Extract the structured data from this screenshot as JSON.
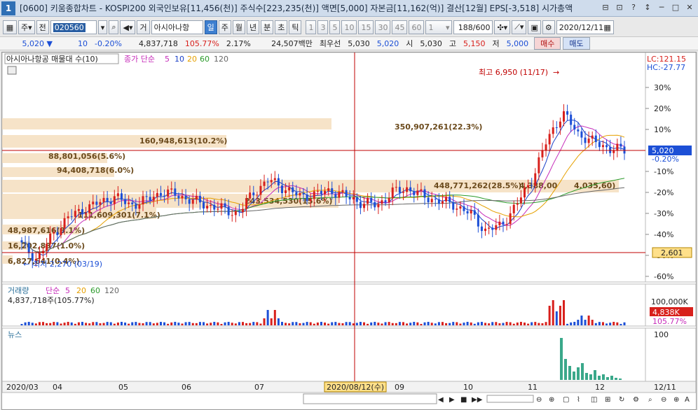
{
  "window": {
    "number": "1",
    "title": "[0600] 키움종합차트 - KOSPI200 외국인보유[11,456(천)] 주식수[223,235(천)] 액면[5,000] 자본금[11,162(억)] 결산[12월] EPS[-3,518] 시가총액",
    "buttons": [
      "⊟",
      "⊡",
      "?",
      "↕",
      "─",
      "□",
      "✕"
    ]
  },
  "toolbar": {
    "type_value": "주",
    "prev_label": "전",
    "code_value": "020560",
    "group_label": "거",
    "stock_name": "아시아나항",
    "periods": [
      "일",
      "주",
      "월",
      "년",
      "분",
      "초",
      "틱"
    ],
    "selected_period": "일",
    "intervals": [
      "1",
      "3",
      "5",
      "10",
      "15",
      "30",
      "45",
      "60"
    ],
    "interval_select": "1",
    "count": "188/600",
    "date": "2020/12/11"
  },
  "quote": {
    "price": "5,020",
    "change": "10",
    "change_pct": "-0.20%",
    "volume": "4,837,718",
    "volume_ratio": "105.77%",
    "turnover": "2.17%",
    "amount": "24,507백만",
    "best_label": "최우선",
    "best_ask": "5,030",
    "best_bid": "5,020",
    "open_label": "시",
    "open": "5,030",
    "high_label": "고",
    "high": "5,150",
    "low_label": "저",
    "low": "5,000",
    "buy_label": "매수",
    "sell_label": "매도"
  },
  "colors": {
    "up": "#d8201c",
    "down": "#1c4fd6",
    "ma5": "#1a3fc7",
    "ma10": "#c62bb9",
    "ma20": "#e6a000",
    "ma60": "#2a9a2a",
    "ma120": "#666666",
    "crosshair": "#c00000",
    "profile": "#f6e3c8"
  },
  "price_pane": {
    "legend_name": "아시아나항공 매물대 수(10)",
    "legend_ma_label": "종가 단순",
    "legend_periods": [
      "5",
      "10",
      "20",
      "60",
      "120"
    ],
    "lc_label": "LC:121.15",
    "hc_label": "HC:-27.77",
    "high_marker": "최고 6,950 (11/17)",
    "low_marker": "최저 2,270 (03/19)",
    "current_price_tag": "5,020",
    "current_pct": "-0.20%",
    "line_tag": "2,601",
    "pct_ticks": [
      "30%",
      "20%",
      "10%",
      "-10%",
      "-20%",
      "-30%",
      "-40%",
      "-50%",
      "-60%"
    ],
    "profile_labels": [
      "350,907,261(22.3%)",
      "160,948,613(10.2%)",
      "88,801,056(5.6%)",
      "94,408,718(6.0%)",
      "448,771,262(28.5%)",
      "4,388,00",
      "4,035,60)",
      "243,534,530(15.6%)",
      "111,609,301(7.1%)",
      "48,987,616(3.1%)",
      "16,202,837(1.0%)",
      "6,827,641(0.4%)"
    ]
  },
  "volume_pane": {
    "legend_name": "거래량",
    "legend_ma_label": "단순",
    "legend_periods": [
      "5",
      "20",
      "60",
      "120"
    ],
    "value_label": "4,837,718주(105.77%)",
    "axis_label": "100,000K",
    "tag_value": "4,838K",
    "tag_pct": "105.77%"
  },
  "news_pane": {
    "legend_name": "뉴스",
    "axis_label": "100"
  },
  "x_axis": {
    "labels": [
      "2020/03",
      "04",
      "05",
      "06",
      "07",
      "09",
      "10",
      "11",
      "12",
      "12/11"
    ],
    "crosshair_date": "2020/08/12(수)"
  },
  "chart_data": {
    "type": "candlestick",
    "y_unit": "% change",
    "monthly_marks": [
      "2020/03",
      "04",
      "05",
      "06",
      "07",
      "08",
      "09",
      "10",
      "11",
      "12"
    ],
    "close_path_pct": [
      -45,
      -52,
      -40,
      -32,
      -28,
      -25,
      -22,
      -26,
      -24,
      -20,
      -21,
      -24,
      -26,
      -28,
      -30,
      -20,
      -14,
      -18,
      -22,
      -21,
      -19,
      -22,
      -25,
      -26,
      -20,
      -18,
      -22,
      -24,
      -26,
      -30,
      -38,
      -36,
      -26,
      -14,
      5,
      18,
      8,
      4,
      1,
      0
    ],
    "volume_spikes": [
      {
        "date": "2020/08",
        "value": 4
      },
      {
        "date": "2020/11/17",
        "value": 8
      }
    ]
  }
}
